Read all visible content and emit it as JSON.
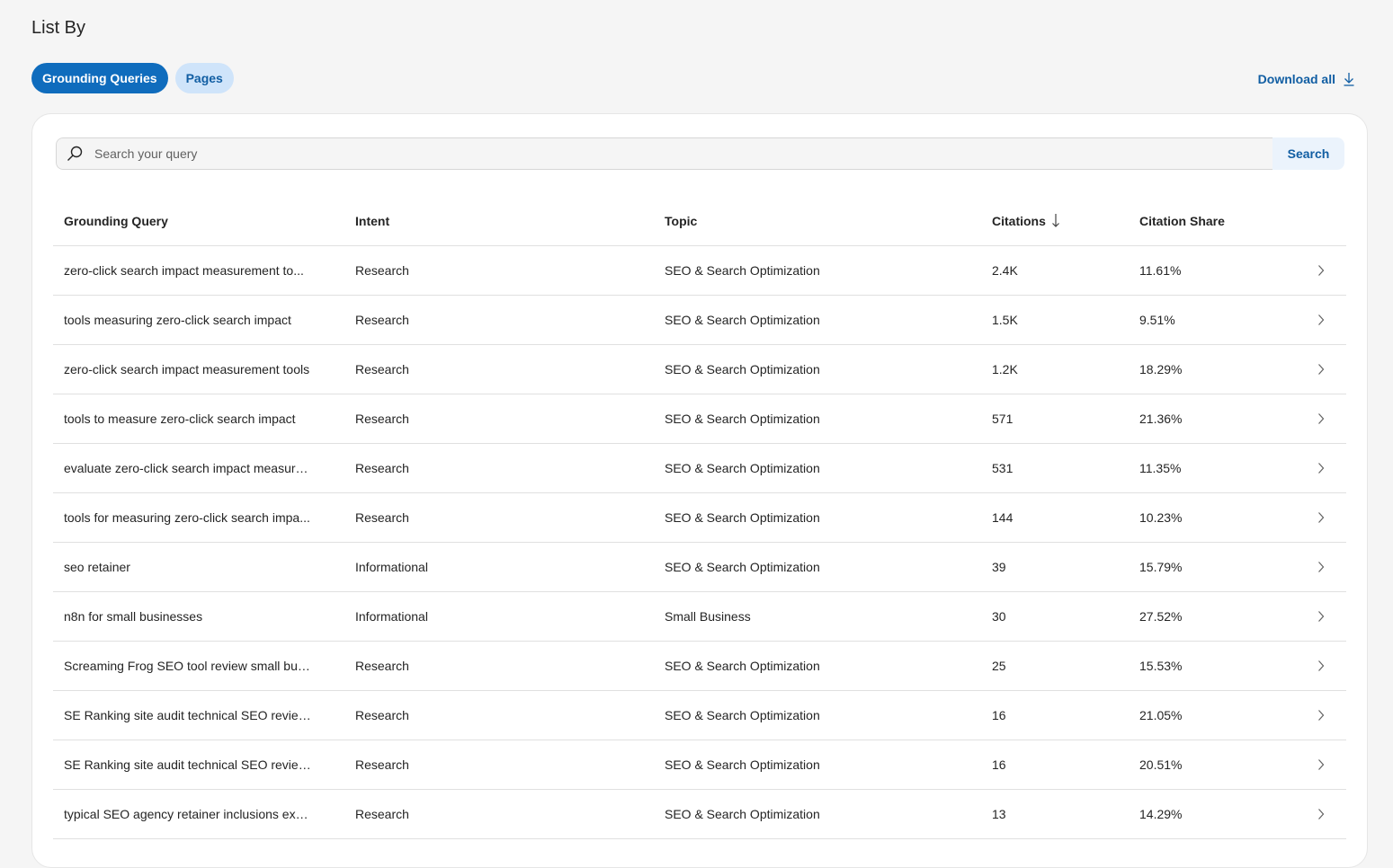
{
  "page": {
    "title": "List By"
  },
  "toggles": [
    {
      "label": "Grounding Queries",
      "active": true
    },
    {
      "label": "Pages",
      "active": false
    }
  ],
  "download": {
    "label": "Download all",
    "icon": "download-icon"
  },
  "search": {
    "placeholder": "Search your query",
    "value": "",
    "button_label": "Search",
    "icon": "search-icon"
  },
  "table": {
    "columns": {
      "query": "Grounding Query",
      "intent": "Intent",
      "topic": "Topic",
      "citations": "Citations",
      "share": "Citation Share"
    },
    "sort": {
      "column": "citations",
      "direction": "desc",
      "icon": "arrow-down-icon"
    },
    "rows": [
      {
        "query": "zero-click search impact measurement to...",
        "intent": "Research",
        "topic": "SEO & Search Optimization",
        "citations": "2.4K",
        "share": "11.61%"
      },
      {
        "query": "tools measuring zero-click search impact",
        "intent": "Research",
        "topic": "SEO & Search Optimization",
        "citations": "1.5K",
        "share": "9.51%"
      },
      {
        "query": "zero-click search impact measurement tools",
        "intent": "Research",
        "topic": "SEO & Search Optimization",
        "citations": "1.2K",
        "share": "18.29%"
      },
      {
        "query": "tools to measure zero-click search impact",
        "intent": "Research",
        "topic": "SEO & Search Optimization",
        "citations": "571",
        "share": "21.36%"
      },
      {
        "query": "evaluate zero-click search impact measure...",
        "intent": "Research",
        "topic": "SEO & Search Optimization",
        "citations": "531",
        "share": "11.35%"
      },
      {
        "query": "tools for measuring zero-click search impa...",
        "intent": "Research",
        "topic": "SEO & Search Optimization",
        "citations": "144",
        "share": "10.23%"
      },
      {
        "query": "seo retainer",
        "intent": "Informational",
        "topic": "SEO & Search Optimization",
        "citations": "39",
        "share": "15.79%"
      },
      {
        "query": "n8n for small businesses",
        "intent": "Informational",
        "topic": "Small Business",
        "citations": "30",
        "share": "27.52%"
      },
      {
        "query": "Screaming Frog SEO tool review small bus...",
        "intent": "Research",
        "topic": "SEO & Search Optimization",
        "citations": "25",
        "share": "15.53%"
      },
      {
        "query": "SE Ranking site audit technical SEO review...",
        "intent": "Research",
        "topic": "SEO & Search Optimization",
        "citations": "16",
        "share": "21.05%"
      },
      {
        "query": "SE Ranking site audit technical SEO review...",
        "intent": "Research",
        "topic": "SEO & Search Optimization",
        "citations": "16",
        "share": "20.51%"
      },
      {
        "query": "typical SEO agency retainer inclusions extr...",
        "intent": "Research",
        "topic": "SEO & Search Optimization",
        "citations": "13",
        "share": "14.29%"
      }
    ]
  },
  "colors": {
    "accent": "#0f6cbd",
    "accent_light": "#cfe4fa",
    "link": "#115ea3",
    "background": "#f5f5f5"
  }
}
